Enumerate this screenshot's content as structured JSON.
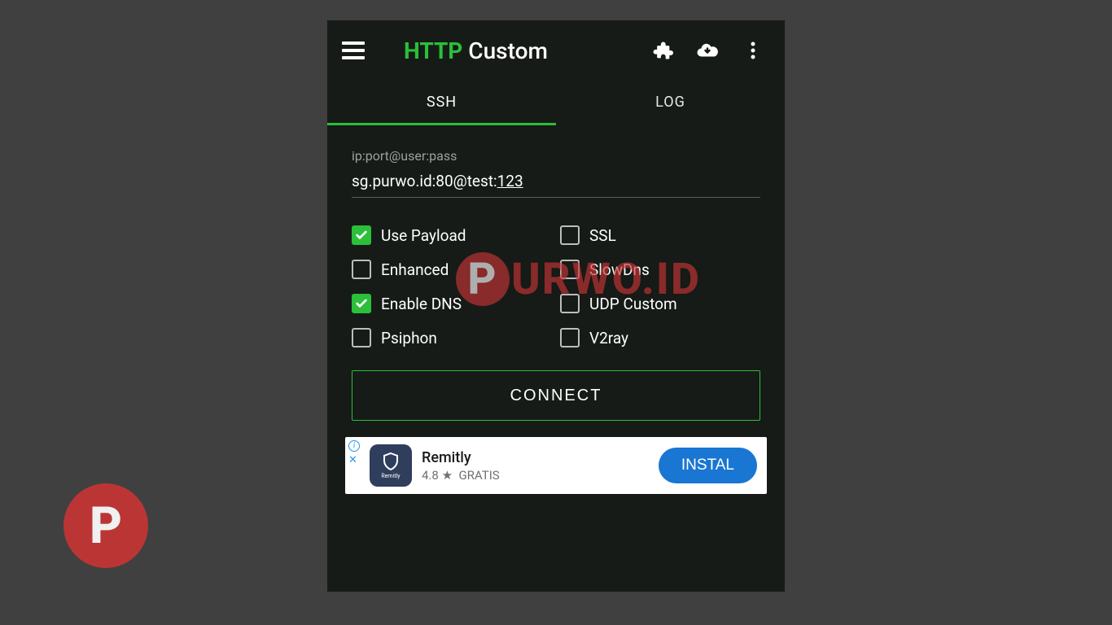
{
  "app": {
    "title_http": "HTTP",
    "title_custom": " Custom"
  },
  "tabs": {
    "ssh": "SSH",
    "log": "LOG"
  },
  "ssh": {
    "field_label": "ip:port@user:pass",
    "field_value_plain": "sg.purwo.id:80@test:",
    "field_value_underlined": "123"
  },
  "options": {
    "use_payload": "Use Payload",
    "ssl": "SSL",
    "enhanced": "Enhanced",
    "slowdns": "SlowDns",
    "enable_dns": "Enable DNS",
    "udp_custom": "UDP Custom",
    "psiphon": "Psiphon",
    "v2ray": "V2ray"
  },
  "checked": {
    "use_payload": true,
    "enable_dns": true
  },
  "connect_label": "CONNECT",
  "ad": {
    "icon_text": "Remitly",
    "title": "Remitly",
    "rating": "4.8",
    "star": "★",
    "price": "GRATIS",
    "button": "INSTAL"
  },
  "watermark": {
    "letter": "P",
    "rest": "URWO.ID"
  },
  "badge_letter": "P"
}
